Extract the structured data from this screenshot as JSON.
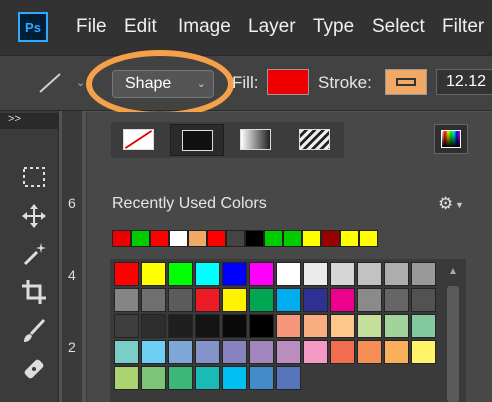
{
  "app": {
    "logo": "Ps"
  },
  "menu": [
    "File",
    "Edit",
    "Image",
    "Layer",
    "Type",
    "Select",
    "Filter"
  ],
  "options": {
    "tool_icon": "line-tool-icon",
    "mode_value": "Shape",
    "fill_label": "Fill:",
    "fill_color": "#ee0000",
    "stroke_label": "Stroke:",
    "stroke_color": "#f3a966",
    "stroke_width": "12.12"
  },
  "toolbar": {
    "collapse_label": ">>",
    "tools": [
      "marquee-icon",
      "move-icon",
      "magic-wand-icon",
      "crop-icon",
      "brush-icon",
      "healing-icon"
    ]
  },
  "ruler": {
    "numbers": [
      "6",
      "4",
      "2"
    ]
  },
  "fill_panel": {
    "fill_types": [
      "no-color",
      "solid-color",
      "gradient",
      "pattern"
    ],
    "selected_fill_type": "solid-color",
    "recent_title": "Recently Used Colors",
    "recent_colors": [
      "#ee0000",
      "#00cc00",
      "#ff0000",
      "#ffffff",
      "#f3a966",
      "#ff0000",
      "#444444",
      "#000000",
      "#00cc00",
      "#00cc00",
      "#ffff00",
      "#990000",
      "#ffff00",
      "#ffff00"
    ],
    "swatches": [
      [
        "#ff0000",
        "#ffff00",
        "#00ff00",
        "#00ffff",
        "#0000ff",
        "#ff00ff",
        "#ffffff",
        "#ebebeb",
        "#d6d6d6",
        "#c2c2c2",
        "#adadad"
      ],
      [
        "#999999",
        "#858585",
        "#707070",
        "#5c5c5c",
        "#ed1c24",
        "#fff200",
        "#00a651",
        "#00aeef",
        "#2e3192",
        "#ec008c",
        "#8a8a8a"
      ],
      [
        "#666666",
        "#525252",
        "#3d3d3d",
        "#2e2e2e",
        "#1f1f1f",
        "#141414",
        "#0a0a0a",
        "#000000",
        "#f7977a",
        "#f9ad81",
        "#fdc68a"
      ],
      [
        "#c4df9b",
        "#a3d39c",
        "#82ca9d",
        "#7bcdc8",
        "#6ecff6",
        "#7ea7d8",
        "#8493ca",
        "#8882be",
        "#a187be",
        "#bc8dbf",
        "#f49ac2"
      ],
      [
        "#f26c4f",
        "#f68e55",
        "#fbaf5c",
        "#fff467",
        "#acd372",
        "#7cc576",
        "#3bb878",
        "#1abbb4",
        "#00bff3",
        "#438ccb",
        "#5574b9"
      ]
    ]
  }
}
